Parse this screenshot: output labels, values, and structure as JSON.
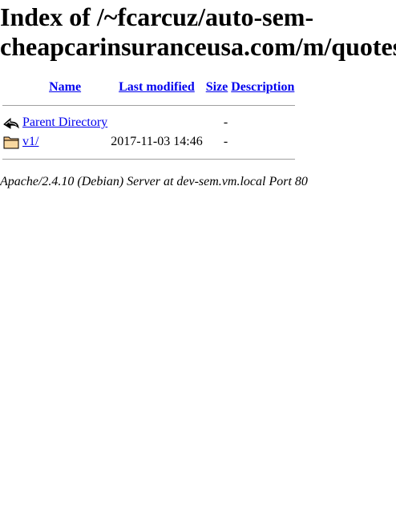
{
  "title": {
    "line1": "Index of /~fcarcuz/auto-sem-",
    "line2": "cheapcarinsuranceusa.com/m/quotes"
  },
  "columns": {
    "name": "Name",
    "last_modified": "Last modified",
    "size": "Size",
    "description": "Description"
  },
  "rows": [
    {
      "icon": "back-arrow-icon",
      "name": "Parent Directory",
      "last_modified": "",
      "size": "-",
      "description": ""
    },
    {
      "icon": "folder-icon",
      "name": "v1/",
      "last_modified": "2017-11-03 14:46",
      "size": "-",
      "description": ""
    }
  ],
  "footer": "Apache/2.4.10 (Debian) Server at dev-sem.vm.local Port 80"
}
